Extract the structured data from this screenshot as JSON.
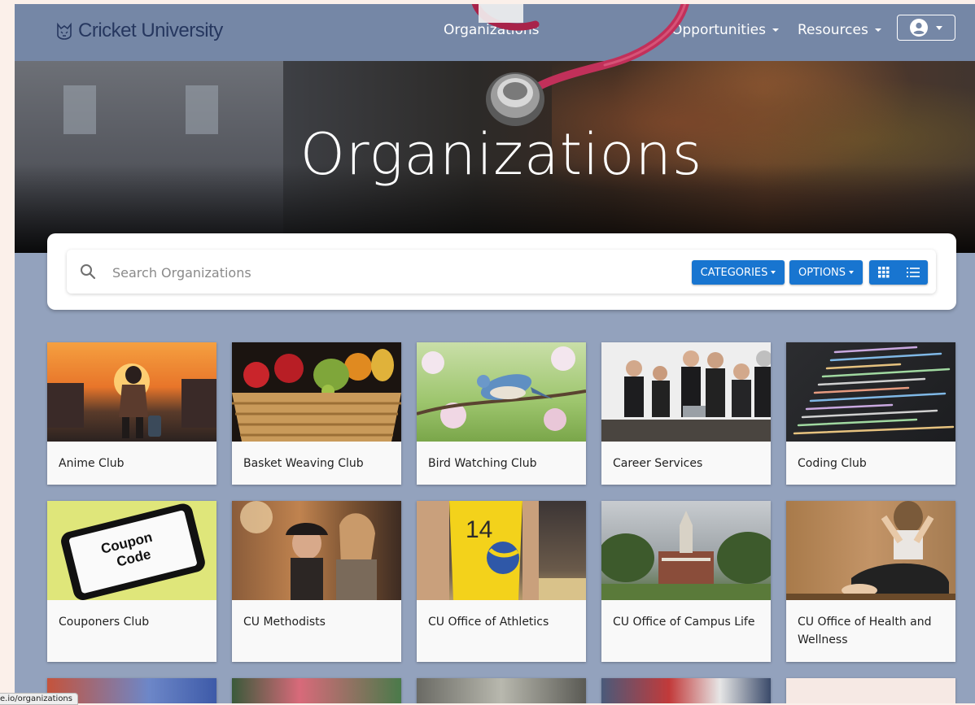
{
  "nav": {
    "logo": "Cricket University",
    "links": [
      {
        "label": "Organizations",
        "caret": false
      },
      {
        "label": "Opportunities",
        "caret": true
      },
      {
        "label": "Resources",
        "caret": true
      }
    ]
  },
  "hero": {
    "title": "Organizations"
  },
  "search": {
    "placeholder": "Search Organizations",
    "categories_label": "CATEGORIES",
    "options_label": "OPTIONS"
  },
  "organizations": [
    {
      "name": "Anime Club"
    },
    {
      "name": "Basket Weaving Club"
    },
    {
      "name": "Bird Watching Club"
    },
    {
      "name": "Career Services"
    },
    {
      "name": "Coding Club"
    },
    {
      "name": "Couponers Club"
    },
    {
      "name": "CU Methodists"
    },
    {
      "name": "CU Office of Athletics"
    },
    {
      "name": "CU Office of Campus Life"
    },
    {
      "name": "CU Office of Health and Wellness"
    }
  ],
  "coupon_image": {
    "line1": "Coupon",
    "line2": "Code"
  },
  "status_bar": {
    "url": "e.io/organizations"
  },
  "colors": {
    "accent": "#1875d0",
    "nav": "#7587a6",
    "page": "#93a2bd",
    "logo": "#26375f"
  }
}
